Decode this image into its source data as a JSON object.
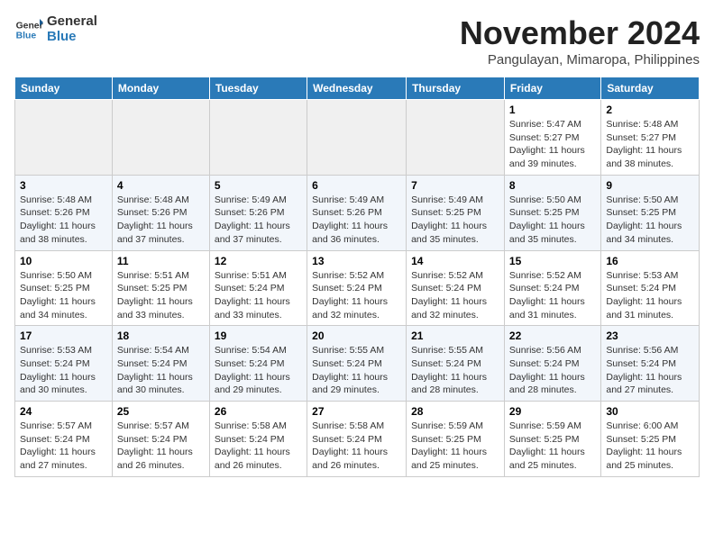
{
  "header": {
    "logo_line1": "General",
    "logo_line2": "Blue",
    "month_year": "November 2024",
    "location": "Pangulayan, Mimaropa, Philippines"
  },
  "weekdays": [
    "Sunday",
    "Monday",
    "Tuesday",
    "Wednesday",
    "Thursday",
    "Friday",
    "Saturday"
  ],
  "weeks": [
    [
      {
        "day": "",
        "info": ""
      },
      {
        "day": "",
        "info": ""
      },
      {
        "day": "",
        "info": ""
      },
      {
        "day": "",
        "info": ""
      },
      {
        "day": "",
        "info": ""
      },
      {
        "day": "1",
        "info": "Sunrise: 5:47 AM\nSunset: 5:27 PM\nDaylight: 11 hours and 39 minutes."
      },
      {
        "day": "2",
        "info": "Sunrise: 5:48 AM\nSunset: 5:27 PM\nDaylight: 11 hours and 38 minutes."
      }
    ],
    [
      {
        "day": "3",
        "info": "Sunrise: 5:48 AM\nSunset: 5:26 PM\nDaylight: 11 hours and 38 minutes."
      },
      {
        "day": "4",
        "info": "Sunrise: 5:48 AM\nSunset: 5:26 PM\nDaylight: 11 hours and 37 minutes."
      },
      {
        "day": "5",
        "info": "Sunrise: 5:49 AM\nSunset: 5:26 PM\nDaylight: 11 hours and 37 minutes."
      },
      {
        "day": "6",
        "info": "Sunrise: 5:49 AM\nSunset: 5:26 PM\nDaylight: 11 hours and 36 minutes."
      },
      {
        "day": "7",
        "info": "Sunrise: 5:49 AM\nSunset: 5:25 PM\nDaylight: 11 hours and 35 minutes."
      },
      {
        "day": "8",
        "info": "Sunrise: 5:50 AM\nSunset: 5:25 PM\nDaylight: 11 hours and 35 minutes."
      },
      {
        "day": "9",
        "info": "Sunrise: 5:50 AM\nSunset: 5:25 PM\nDaylight: 11 hours and 34 minutes."
      }
    ],
    [
      {
        "day": "10",
        "info": "Sunrise: 5:50 AM\nSunset: 5:25 PM\nDaylight: 11 hours and 34 minutes."
      },
      {
        "day": "11",
        "info": "Sunrise: 5:51 AM\nSunset: 5:25 PM\nDaylight: 11 hours and 33 minutes."
      },
      {
        "day": "12",
        "info": "Sunrise: 5:51 AM\nSunset: 5:24 PM\nDaylight: 11 hours and 33 minutes."
      },
      {
        "day": "13",
        "info": "Sunrise: 5:52 AM\nSunset: 5:24 PM\nDaylight: 11 hours and 32 minutes."
      },
      {
        "day": "14",
        "info": "Sunrise: 5:52 AM\nSunset: 5:24 PM\nDaylight: 11 hours and 32 minutes."
      },
      {
        "day": "15",
        "info": "Sunrise: 5:52 AM\nSunset: 5:24 PM\nDaylight: 11 hours and 31 minutes."
      },
      {
        "day": "16",
        "info": "Sunrise: 5:53 AM\nSunset: 5:24 PM\nDaylight: 11 hours and 31 minutes."
      }
    ],
    [
      {
        "day": "17",
        "info": "Sunrise: 5:53 AM\nSunset: 5:24 PM\nDaylight: 11 hours and 30 minutes."
      },
      {
        "day": "18",
        "info": "Sunrise: 5:54 AM\nSunset: 5:24 PM\nDaylight: 11 hours and 30 minutes."
      },
      {
        "day": "19",
        "info": "Sunrise: 5:54 AM\nSunset: 5:24 PM\nDaylight: 11 hours and 29 minutes."
      },
      {
        "day": "20",
        "info": "Sunrise: 5:55 AM\nSunset: 5:24 PM\nDaylight: 11 hours and 29 minutes."
      },
      {
        "day": "21",
        "info": "Sunrise: 5:55 AM\nSunset: 5:24 PM\nDaylight: 11 hours and 28 minutes."
      },
      {
        "day": "22",
        "info": "Sunrise: 5:56 AM\nSunset: 5:24 PM\nDaylight: 11 hours and 28 minutes."
      },
      {
        "day": "23",
        "info": "Sunrise: 5:56 AM\nSunset: 5:24 PM\nDaylight: 11 hours and 27 minutes."
      }
    ],
    [
      {
        "day": "24",
        "info": "Sunrise: 5:57 AM\nSunset: 5:24 PM\nDaylight: 11 hours and 27 minutes."
      },
      {
        "day": "25",
        "info": "Sunrise: 5:57 AM\nSunset: 5:24 PM\nDaylight: 11 hours and 26 minutes."
      },
      {
        "day": "26",
        "info": "Sunrise: 5:58 AM\nSunset: 5:24 PM\nDaylight: 11 hours and 26 minutes."
      },
      {
        "day": "27",
        "info": "Sunrise: 5:58 AM\nSunset: 5:24 PM\nDaylight: 11 hours and 26 minutes."
      },
      {
        "day": "28",
        "info": "Sunrise: 5:59 AM\nSunset: 5:25 PM\nDaylight: 11 hours and 25 minutes."
      },
      {
        "day": "29",
        "info": "Sunrise: 5:59 AM\nSunset: 5:25 PM\nDaylight: 11 hours and 25 minutes."
      },
      {
        "day": "30",
        "info": "Sunrise: 6:00 AM\nSunset: 5:25 PM\nDaylight: 11 hours and 25 minutes."
      }
    ]
  ]
}
